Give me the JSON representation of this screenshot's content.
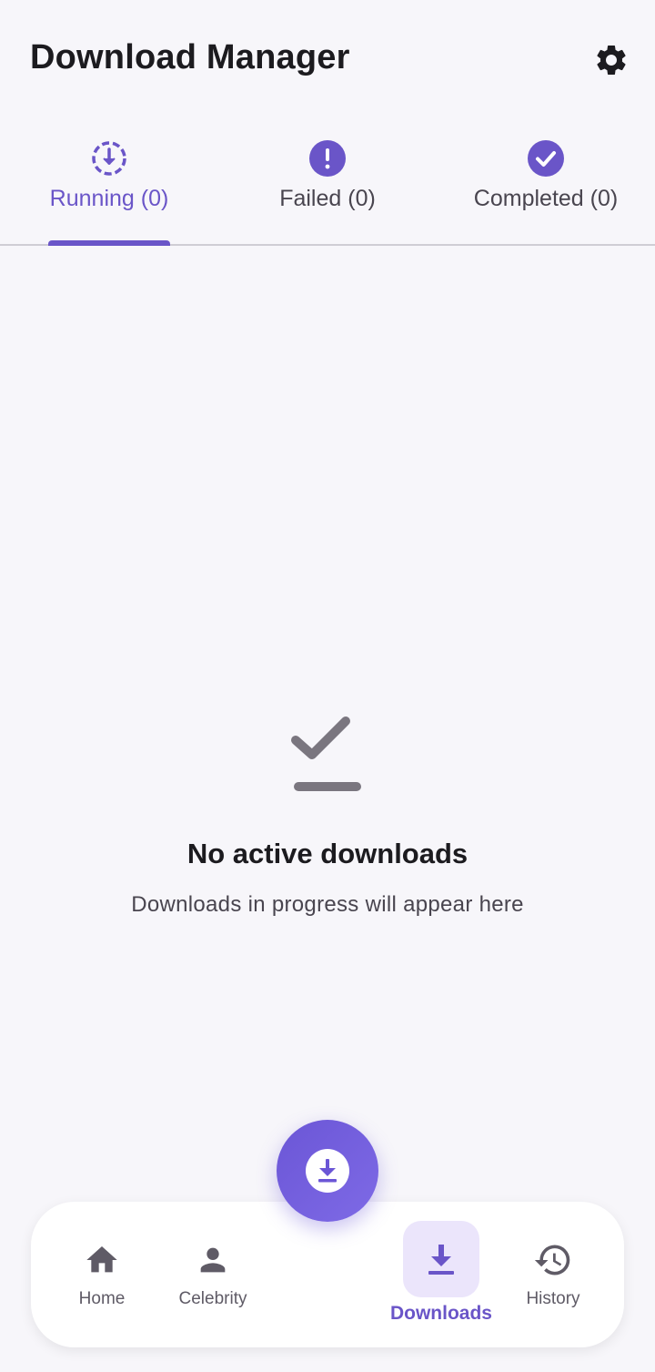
{
  "header": {
    "title": "Download Manager",
    "settings_icon": "gear-icon"
  },
  "tabs": [
    {
      "label": "Running (0)",
      "icon": "download-circle-icon",
      "active": true
    },
    {
      "label": "Failed (0)",
      "icon": "alert-circle-icon",
      "active": false
    },
    {
      "label": "Completed (0)",
      "icon": "check-circle-icon",
      "active": false
    }
  ],
  "empty_state": {
    "icon": "download-done-icon",
    "title": "No active downloads",
    "subtitle": "Downloads in progress will appear here"
  },
  "fab": {
    "icon": "download-circle-icon"
  },
  "bottom_nav": {
    "items": [
      {
        "label": "Home",
        "icon": "home-icon",
        "active": false
      },
      {
        "label": "Celebrity",
        "icon": "person-icon",
        "active": false
      },
      {
        "label": "Downloads",
        "icon": "download-icon",
        "active": true
      },
      {
        "label": "History",
        "icon": "history-icon",
        "active": false
      }
    ]
  },
  "colors": {
    "accent": "#6a55c8",
    "background": "#f7f6fa",
    "text": "#1c1b1f",
    "muted": "#49454f",
    "active_pill": "#ebe5fb"
  }
}
